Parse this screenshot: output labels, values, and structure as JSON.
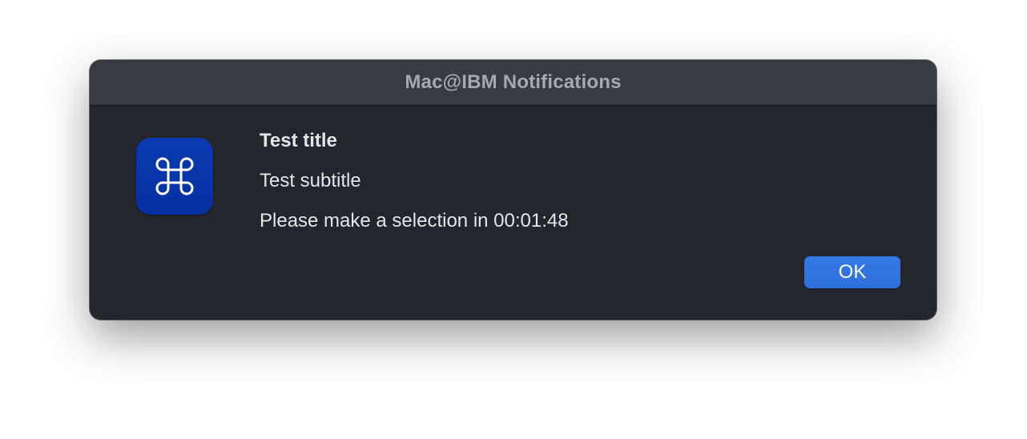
{
  "window": {
    "title": "Mac@IBM Notifications"
  },
  "app_icon": {
    "icon": "command-icon",
    "background_color": "#0a3ab0"
  },
  "message": {
    "title": "Test title",
    "subtitle": "Test subtitle",
    "body": "Please make a selection in 00:01:48"
  },
  "buttons": {
    "ok_label": "OK",
    "ok_color": "#3579e6"
  }
}
